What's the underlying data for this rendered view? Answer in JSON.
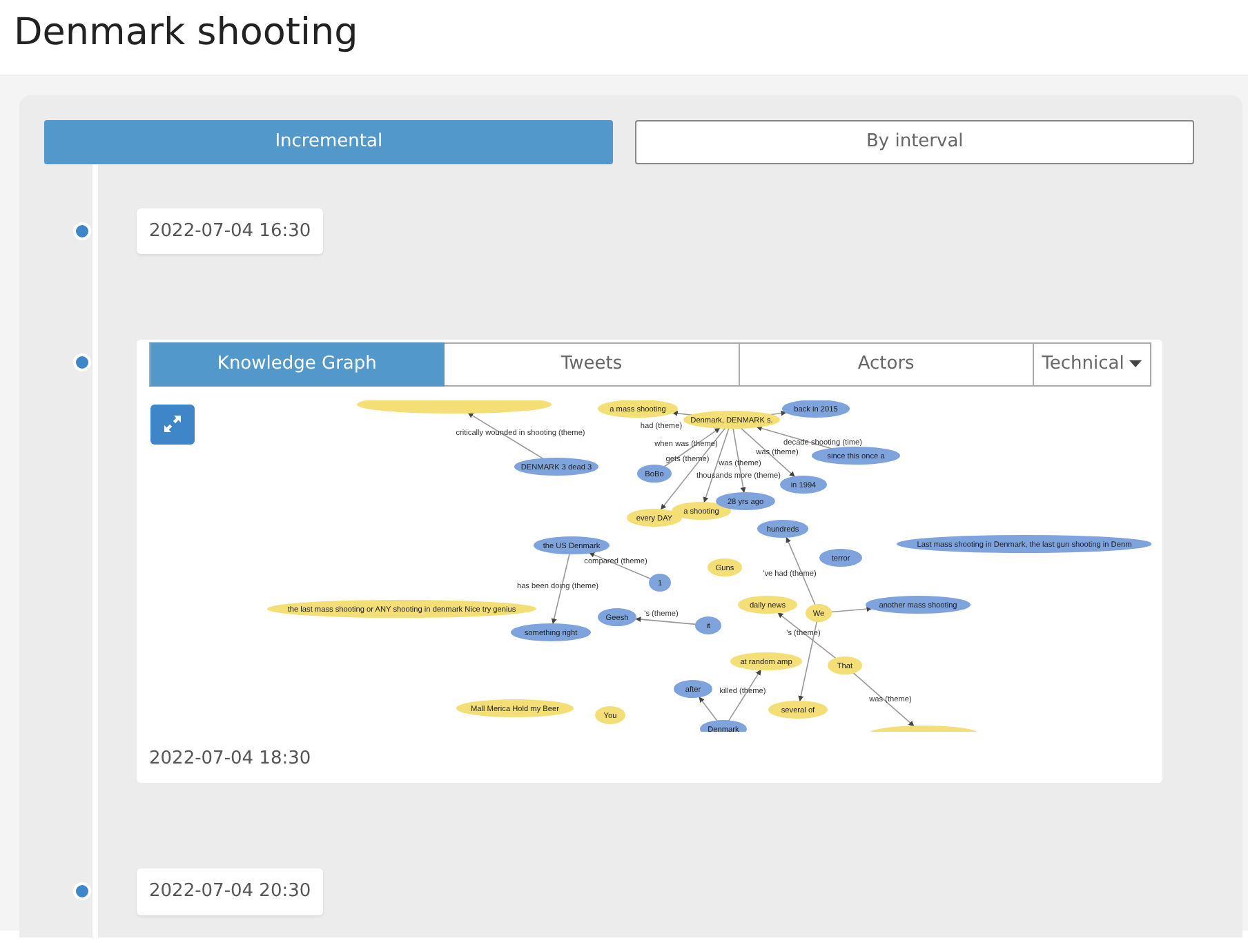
{
  "title": "Denmark shooting",
  "modes": [
    {
      "label": "Incremental",
      "selected": true
    },
    {
      "label": "By interval",
      "selected": false
    }
  ],
  "timeline": [
    {
      "time": "2022-07-04 16:30"
    },
    {
      "time": "2022-07-04 18:30",
      "tabs": [
        {
          "label": "Knowledge Graph",
          "selected": true,
          "kind": "tab"
        },
        {
          "label": "Tweets",
          "selected": false,
          "kind": "tab"
        },
        {
          "label": "Actors",
          "selected": false,
          "kind": "tab"
        },
        {
          "label": "Technical",
          "selected": false,
          "kind": "dropdown"
        }
      ],
      "graph": {
        "nodes": [
          {
            "color": "#f3df75"
          },
          {
            "label": "a mass shooting",
            "color": "#f3df75"
          },
          {
            "label": "Denmark, DENMARK s.",
            "color": "#f3df75"
          },
          {
            "label": "back in 2015",
            "color": "#7fa3dc"
          },
          {
            "label": "DENMARK 3 dead 3",
            "color": "#7fa3dc"
          },
          {
            "label": "BoBo",
            "color": "#7fa3dc"
          },
          {
            "label": "since this once a",
            "color": "#7fa3dc"
          },
          {
            "label": "in 1994",
            "color": "#7fa3dc"
          },
          {
            "label": "every DAY",
            "color": "#f3df75"
          },
          {
            "label": "a shooting",
            "color": "#f3df75"
          },
          {
            "label": "28 yrs ago",
            "color": "#7fa3dc"
          },
          {
            "label": "hundreds",
            "color": "#7fa3dc"
          },
          {
            "label": "the US Denmark",
            "color": "#7fa3dc"
          },
          {
            "label": "Last mass shooting in Denmark, the last gun shooting in Denm",
            "color": "#7fa3dc"
          },
          {
            "label": "terror",
            "color": "#7fa3dc"
          },
          {
            "label": "1",
            "color": "#7fa3dc"
          },
          {
            "label": "Guns",
            "color": "#f3df75"
          },
          {
            "label": "the last mass shooting or ANY shooting in denmark Nice try genius",
            "color": "#f3df75"
          },
          {
            "label": "daily news",
            "color": "#f3df75"
          },
          {
            "label": "We",
            "color": "#f3df75"
          },
          {
            "label": "another mass shooting",
            "color": "#7fa3dc"
          },
          {
            "label": "Geesh",
            "color": "#7fa3dc"
          },
          {
            "label": "it",
            "color": "#7fa3dc"
          },
          {
            "label": "something right",
            "color": "#7fa3dc"
          },
          {
            "label": "at random amp",
            "color": "#f3df75"
          },
          {
            "label": "That",
            "color": "#f3df75"
          },
          {
            "label": "after",
            "color": "#7fa3dc"
          },
          {
            "label": "several of",
            "color": "#f3df75"
          },
          {
            "label": "Mall Merica Hold my Beer",
            "color": "#f3df75"
          },
          {
            "label": "You",
            "color": "#f3df75"
          },
          {
            "label": "Denmark",
            "color": "#7fa3dc"
          },
          {
            "color": "#f3df75"
          }
        ],
        "edges": [
          {
            "label": "critically wounded in shooting (theme)"
          },
          {
            "label": "had (theme)"
          },
          {
            "label": "when was (theme)"
          },
          {
            "label": "decade shooting (time)"
          },
          {
            "label": "gets (theme)"
          },
          {
            "label": "was (theme)"
          },
          {
            "label": "was (theme)"
          },
          {
            "label": "thousands more (theme)"
          },
          {
            "label": "'ve had (theme)"
          },
          {
            "label": "compared (theme)"
          },
          {
            "label": "has been doing (theme)"
          },
          {
            "label": "'s (theme)"
          },
          {
            "label": "'s (theme)"
          },
          {
            "label": "killed (theme)"
          },
          {
            "label": "was (theme)"
          }
        ]
      }
    },
    {
      "time": "2022-07-04 20:30"
    }
  ]
}
